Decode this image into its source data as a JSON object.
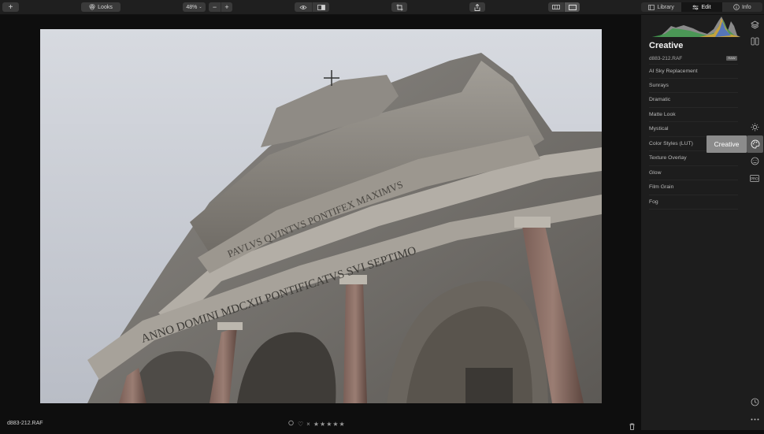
{
  "toolbar": {
    "add_label": "+",
    "looks_label": "Looks",
    "zoom_value": "48%",
    "zoom_minus": "−",
    "zoom_plus": "+"
  },
  "tabs": [
    {
      "label": "Library",
      "icon": "library-icon"
    },
    {
      "label": "Edit",
      "icon": "sliders-icon"
    },
    {
      "label": "Info",
      "icon": "info-icon"
    }
  ],
  "panel": {
    "title": "Creative",
    "filename": "d883-212.RAF",
    "badge": "RAW",
    "tools": [
      "AI Sky Replacement",
      "Sunrays",
      "Dramatic",
      "Matte Look",
      "Mystical",
      "Color Styles (LUT)",
      "Texture Overlay",
      "Glow",
      "Film Grain",
      "Fog"
    ],
    "tooltip": "Creative"
  },
  "bottom": {
    "filename": "d883-212.RAF",
    "reject": "×",
    "stars": "★★★★★"
  },
  "photo": {
    "inscription_1": "PAVLVS QVINTVS PONTIFEX MAXIMVS",
    "inscription_2": "ANNO DOMINI MDCXII PONTIFICATVS SVI SEPTIMO"
  },
  "colors": {
    "accent_tooltip": "#8c8c8c",
    "panel_bg": "#1d1d1d",
    "toolbar_bg": "#1f1f1f"
  }
}
